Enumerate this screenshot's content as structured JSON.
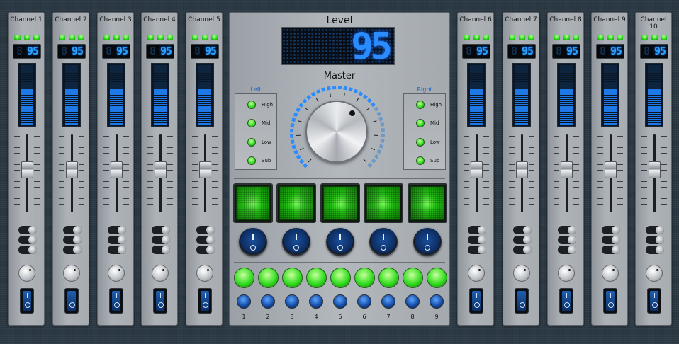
{
  "left_channels": [
    {
      "label": "Channel 1",
      "level": "95"
    },
    {
      "label": "Channel 2",
      "level": "95"
    },
    {
      "label": "Channel 3",
      "level": "95"
    },
    {
      "label": "Channel 4",
      "level": "95"
    },
    {
      "label": "Channel 5",
      "level": "95"
    }
  ],
  "right_channels": [
    {
      "label": "Channel 6",
      "level": "95"
    },
    {
      "label": "Channel 7",
      "level": "95"
    },
    {
      "label": "Channel 8",
      "level": "95"
    },
    {
      "label": "Channel 9",
      "level": "95"
    },
    {
      "label": "Channel 10",
      "level": "95"
    }
  ],
  "master": {
    "level_title": "Level",
    "level_value": "95",
    "master_label": "Master",
    "left_title": "Left",
    "right_title": "Right",
    "bands": [
      "High",
      "Mid",
      "Low",
      "Sub"
    ],
    "buttons": [
      "1",
      "2",
      "3",
      "4",
      "5",
      "6",
      "7",
      "8",
      "9"
    ]
  },
  "colors": {
    "led_green": "#33de20",
    "display_blue": "#2b8cff",
    "panel": "#a9aeb3",
    "background": "#2c3a45"
  }
}
